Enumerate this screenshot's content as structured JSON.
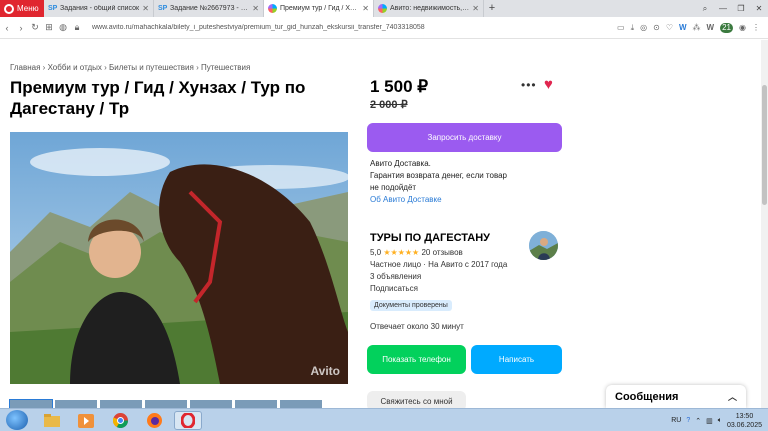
{
  "browser": {
    "menu_label": "Меню",
    "tabs": [
      {
        "label": "Задания - общий список",
        "icon": "SP"
      },
      {
        "label": "Задание №2667973 - про",
        "icon": "SP"
      },
      {
        "label": "Премиум тур / Гид / Хунз",
        "icon": "avito",
        "active": true
      },
      {
        "label": "Авито: недвижимость, тра",
        "icon": "avito"
      }
    ],
    "url": "www.avito.ru/mahachkala/bilety_i_puteshestviya/premium_tur_gid_hunzah_ekskursii_transfer_7403318058",
    "ext_badge": "21"
  },
  "page": {
    "breadcrumb": [
      "Главная",
      "Хобби и отдых",
      "Билеты и путешествия",
      "Путешествия"
    ],
    "title": "Премиум тур / Гид / Хунзах / Тур по Дагестану / Тр",
    "price": "1 500 ₽",
    "old_price": "2 000 ₽",
    "watermark": "Avito",
    "buttons": {
      "request_delivery": "Запросить доставку",
      "show_phone": "Показать телефон",
      "write": "Написать",
      "contact": "Свяжитесь со мной"
    },
    "delivery": {
      "line1": "Авито Доставка.",
      "line2": "Гарантия возврата денег, если товар",
      "line3": "не подойдёт",
      "link": "Об Авито Доставке"
    },
    "seller": {
      "name": "ТУРЫ ПО ДАГЕСТАНУ",
      "rating": "5,0",
      "stars": "★★★★★",
      "reviews": "20 отзывов",
      "type": "Частное лицо · На Авито с 2017 года",
      "listings": "3 объявления",
      "subscribe": "Подписаться",
      "badge": "Документы проверены",
      "reply_time": "Отвечает около 30 минут"
    },
    "messages_widget": "Сообщения"
  },
  "taskbar": {
    "lang": "RU",
    "time": "13:50",
    "date": "03.06.2025"
  },
  "colors": {
    "accent_purple": "#9b5bf0",
    "phone_green": "#02d15c",
    "write_blue": "#00aaff",
    "heart_red": "#e0264f"
  }
}
